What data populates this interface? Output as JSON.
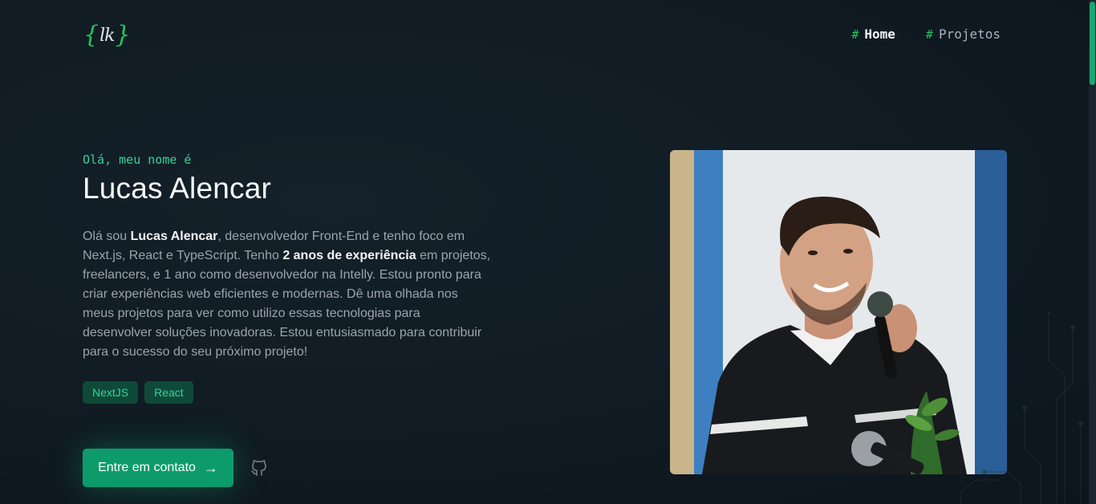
{
  "header": {
    "logo": {
      "left": "{",
      "initials": "lk",
      "right": "}"
    },
    "nav": [
      {
        "hash": "#",
        "label": "Home",
        "active": true
      },
      {
        "hash": "#",
        "label": "Projetos",
        "active": false
      }
    ]
  },
  "hero": {
    "greeting": "Olá, meu nome é",
    "name": "Lucas Alencar",
    "bio": {
      "p1": "Olá sou ",
      "b1": "Lucas Alencar",
      "p2": ", desenvolvedor Front-End e tenho foco em Next.js, React e TypeScript. Tenho ",
      "b2": "2 anos de experiência",
      "p3": " em projetos, freelancers, e 1 ano como desenvolvedor na Intelly. Estou pronto para criar experiências web eficientes e modernas. Dê uma olhada nos meus projetos para ver como utilizo essas tecnologias para desenvolver soluções inovadoras. Estou entusiasmado para contribuir para o sucesso do seu próximo projeto!"
    },
    "tags": [
      "NextJS",
      "React"
    ],
    "cta": {
      "label": "Entre em contato",
      "arrow": "→"
    },
    "social_icon": "github-icon"
  },
  "colors": {
    "accent": "#22c55e",
    "accent_text": "#34d399",
    "button": "#0d9b6c",
    "tag_bg": "#0f4a38",
    "background": "#111c24"
  }
}
